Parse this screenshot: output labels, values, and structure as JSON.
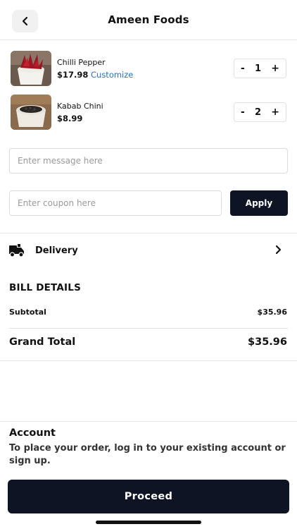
{
  "header": {
    "title": "Ameen Foods",
    "back_icon": "chevron-left-icon"
  },
  "cart": {
    "items": [
      {
        "name": "Chilli Pepper",
        "price": "$17.98",
        "customize_label": "Customize",
        "quantity": "1",
        "decrement": "-",
        "increment": "+",
        "image": "chilli-pepper-image"
      },
      {
        "name": "Kabab Chini",
        "price": "$8.99",
        "quantity": "2",
        "decrement": "-",
        "increment": "+",
        "image": "kabab-chini-image"
      }
    ]
  },
  "message": {
    "placeholder": "Enter message here",
    "value": ""
  },
  "coupon": {
    "placeholder": "Enter coupon here",
    "value": "",
    "apply_label": "Apply"
  },
  "delivery": {
    "label": "Delivery",
    "icon": "delivery-truck-icon",
    "chevron": "chevron-right-icon"
  },
  "bill": {
    "title": "BILL DETAILS",
    "subtotal_label": "Subtotal",
    "subtotal_value": "$35.96",
    "grand_total_label": "Grand Total",
    "grand_total_value": "$35.96"
  },
  "account": {
    "title": "Account",
    "text": "To place your order, log in to your existing account or sign up."
  },
  "proceed": {
    "label": "Proceed"
  },
  "colors": {
    "primary_dark": "#0e1424",
    "link_blue": "#2f6fb0",
    "divider": "#e6e6e6"
  }
}
